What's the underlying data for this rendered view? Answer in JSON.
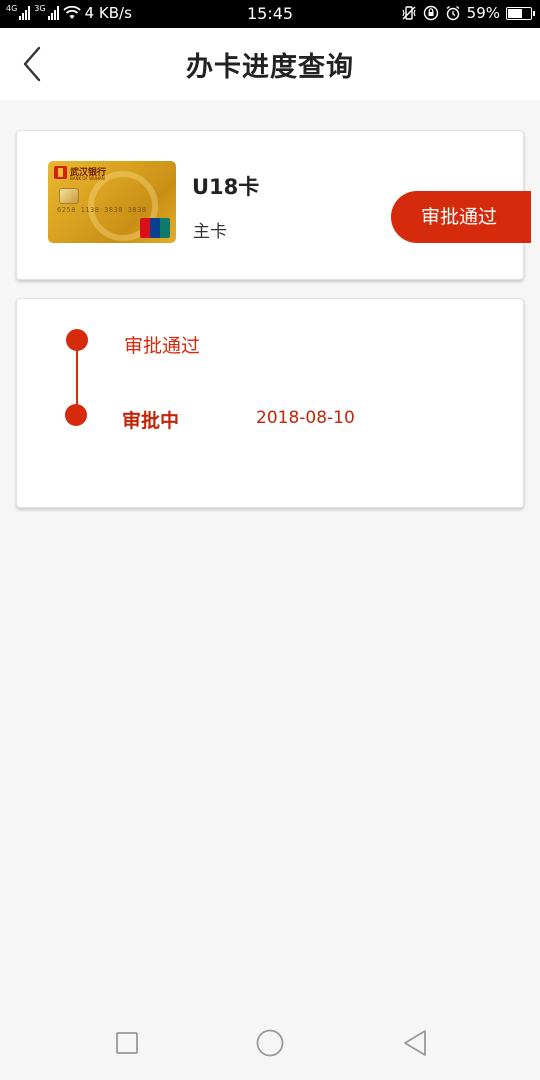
{
  "status_bar": {
    "network_1": "4G",
    "network_2": "3G",
    "speed": "4 KB/s",
    "time": "15:45",
    "battery": "59%"
  },
  "header": {
    "title": "办卡进度查询"
  },
  "card": {
    "image_bank_name": "武汉银行",
    "image_bank_sub": "BANK OF WUHAN",
    "image_card_number": "6258 1138 3838 3838",
    "name": "U18卡",
    "type": "主卡",
    "status": "审批通过"
  },
  "progress": {
    "steps": [
      {
        "label": "审批通过",
        "date": ""
      },
      {
        "label": "审批中",
        "date": "2018-08-10"
      }
    ]
  },
  "colors": {
    "accent": "#d52a0c",
    "background": "#f6f6f6",
    "card_gold": "#d9a220"
  }
}
